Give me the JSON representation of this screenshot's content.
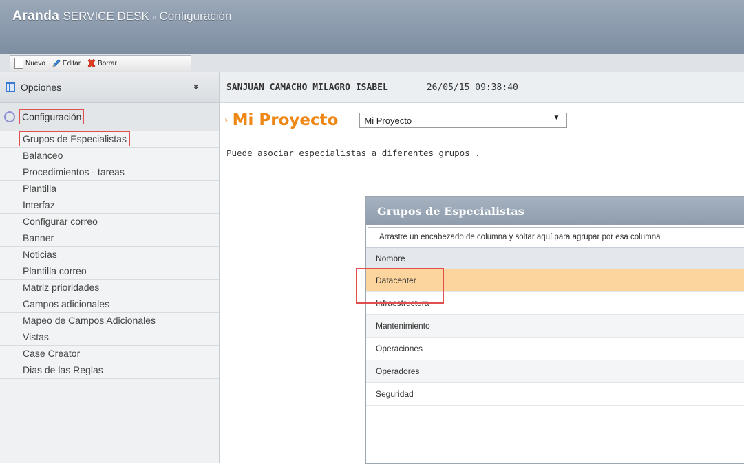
{
  "header": {
    "brand_bold": "Aranda",
    "brand_product": "SERVICE DESK",
    "separator": "»",
    "section": "Configuración"
  },
  "toolbar": {
    "new_label": "Nuevo",
    "edit_label": "Editar",
    "delete_label": "Borrar"
  },
  "sidebar": {
    "options_label": "Opciones",
    "collapse_glyph": "»",
    "config_label": "Configuración",
    "items": [
      {
        "label": "Grupos de Especialistas"
      },
      {
        "label": "Balanceo"
      },
      {
        "label": "Procedimientos - tareas"
      },
      {
        "label": "Plantilla"
      },
      {
        "label": "Interfaz"
      },
      {
        "label": "Configurar correo"
      },
      {
        "label": "Banner"
      },
      {
        "label": "Noticias"
      },
      {
        "label": "Plantilla correo"
      },
      {
        "label": "Matriz prioridades"
      },
      {
        "label": "Campos adicionales"
      },
      {
        "label": "Mapeo de Campos Adicionales"
      },
      {
        "label": "Vistas"
      },
      {
        "label": "Case Creator"
      },
      {
        "label": "Dias de las Reglas"
      }
    ]
  },
  "main": {
    "user_name": "SANJUAN CAMACHO MILAGRO ISABEL",
    "datetime": "26/05/15 09:38:40",
    "project_title": "Mi Proyecto",
    "project_select_value": "Mi Proyecto",
    "description": "Puede asociar especialistas a diferentes grupos ."
  },
  "grid": {
    "title": "Grupos de Especialistas",
    "group_hint": "Arrastre un encabezado de columna y soltar aquí para agrupar por esa columna",
    "column_header": "Nombre",
    "rows": [
      {
        "name": "Datacenter"
      },
      {
        "name": "Infraestructura"
      },
      {
        "name": "Mantenimiento"
      },
      {
        "name": "Operaciones"
      },
      {
        "name": "Operadores"
      },
      {
        "name": "Seguridad"
      }
    ]
  },
  "colors": {
    "accent_orange": "#ef8717",
    "highlight_red": "#e05050",
    "selected_row": "#fbd49e",
    "header_blue": "#8e9cad"
  }
}
